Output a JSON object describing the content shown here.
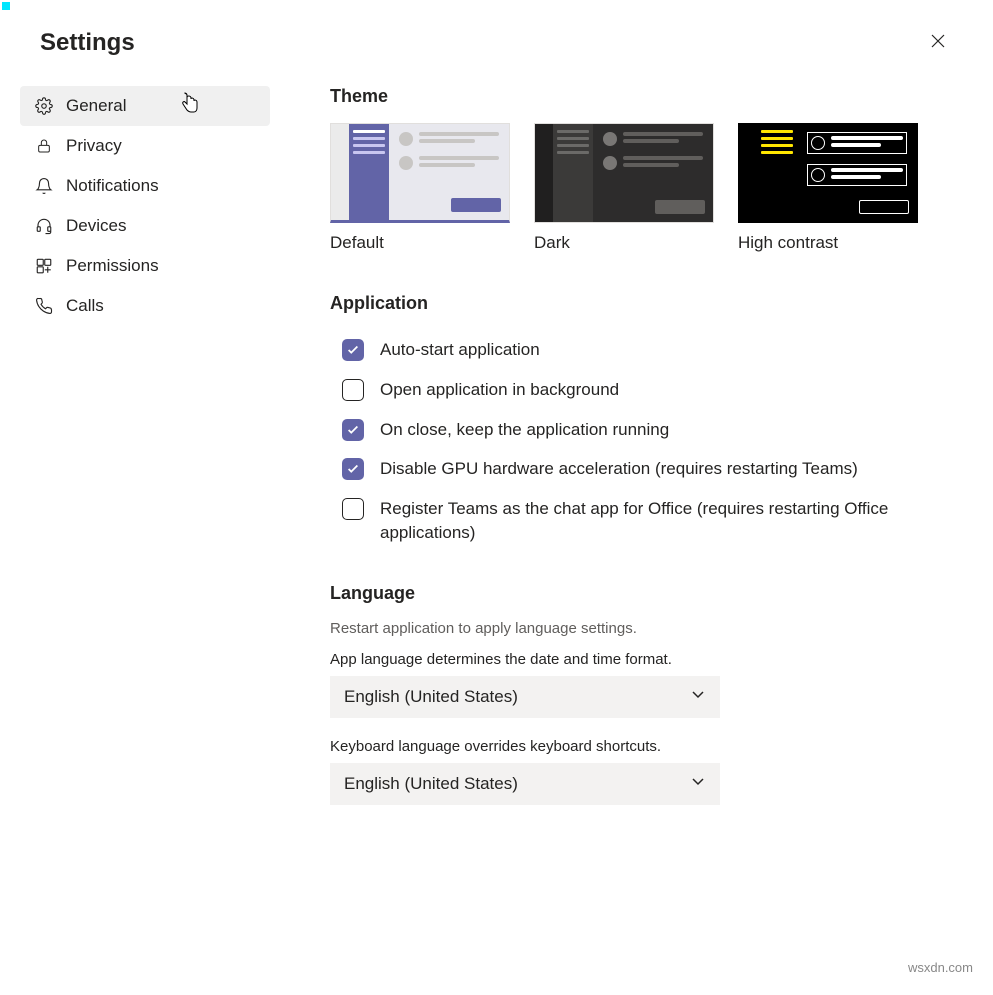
{
  "title": "Settings",
  "sidebar": {
    "items": [
      {
        "label": "General"
      },
      {
        "label": "Privacy"
      },
      {
        "label": "Notifications"
      },
      {
        "label": "Devices"
      },
      {
        "label": "Permissions"
      },
      {
        "label": "Calls"
      }
    ]
  },
  "theme": {
    "heading": "Theme",
    "options": [
      {
        "label": "Default"
      },
      {
        "label": "Dark"
      },
      {
        "label": "High contrast"
      }
    ]
  },
  "application": {
    "heading": "Application",
    "checkboxes": [
      {
        "label": "Auto-start application",
        "checked": true
      },
      {
        "label": "Open application in background",
        "checked": false
      },
      {
        "label": "On close, keep the application running",
        "checked": true
      },
      {
        "label": "Disable GPU hardware acceleration (requires restarting Teams)",
        "checked": true
      },
      {
        "label": "Register Teams as the chat app for Office (requires restarting Office applications)",
        "checked": false
      }
    ]
  },
  "language": {
    "heading": "Language",
    "restart_hint": "Restart application to apply language settings.",
    "app_lang_label": "App language determines the date and time format.",
    "app_lang_value": "English (United States)",
    "kb_lang_label": "Keyboard language overrides keyboard shortcuts.",
    "kb_lang_value": "English (United States)"
  },
  "watermark": "wsxdn.com"
}
